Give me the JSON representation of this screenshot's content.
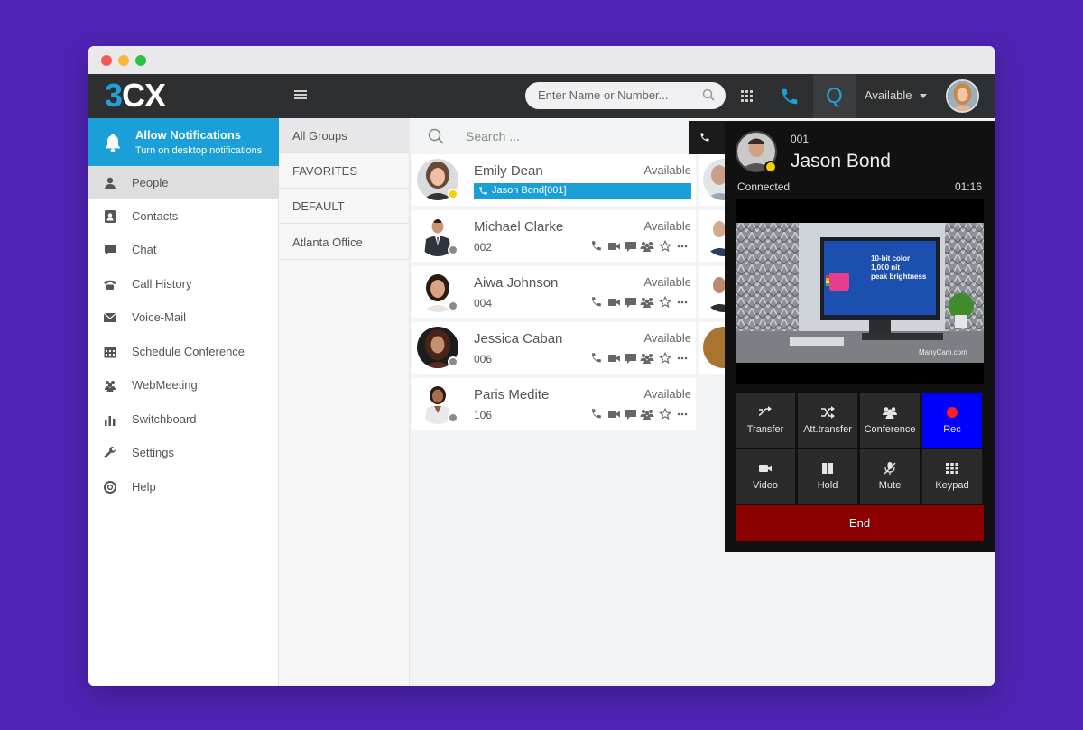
{
  "app": {
    "logo_three": "3",
    "logo_cx": "CX"
  },
  "header": {
    "search_placeholder": "Enter Name or Number...",
    "queue_label": "Q",
    "status": "Available"
  },
  "notification": {
    "title": "Allow Notifications",
    "subtitle": "Turn on desktop notifications"
  },
  "sidebar": {
    "items": [
      {
        "label": "People",
        "icon": "person-icon",
        "active": true
      },
      {
        "label": "Contacts",
        "icon": "contacts-icon"
      },
      {
        "label": "Chat",
        "icon": "chat-icon"
      },
      {
        "label": "Call History",
        "icon": "call-history-icon"
      },
      {
        "label": "Voice-Mail",
        "icon": "voicemail-icon"
      },
      {
        "label": "Schedule Conference",
        "icon": "calendar-icon"
      },
      {
        "label": "WebMeeting",
        "icon": "webmeeting-icon"
      },
      {
        "label": "Switchboard",
        "icon": "switchboard-icon"
      },
      {
        "label": "Settings",
        "icon": "wrench-icon"
      },
      {
        "label": "Help",
        "icon": "help-icon"
      }
    ]
  },
  "groups": {
    "items": [
      "All Groups",
      "FAVORITES",
      "DEFAULT",
      "Atlanta Office"
    ]
  },
  "people": {
    "search_placeholder": "Search ...",
    "contacts": [
      {
        "name": "Emily Dean",
        "status": "Available",
        "ext": "",
        "active_call": "Jason Bond[001]",
        "presence_color": "#f5d000"
      },
      {
        "name": "Michael Clarke",
        "status": "Available",
        "ext": "002",
        "presence_color": "#8a8a8a"
      },
      {
        "name": "Aiwa Johnson",
        "status": "Available",
        "ext": "004",
        "presence_color": "#8a8a8a"
      },
      {
        "name": "Jessica Caban",
        "status": "Available",
        "ext": "006",
        "presence_color": "#8a8a8a"
      },
      {
        "name": "Paris Medite",
        "status": "Available",
        "ext": "106",
        "presence_color": "#8a8a8a"
      }
    ]
  },
  "call": {
    "ext": "001",
    "name": "Jason Bond",
    "status": "Connected",
    "timer": "01:16",
    "video": {
      "monitor_line1": "10-bit color",
      "monitor_line2": "1,000 nit",
      "monitor_line3": "peak brightness",
      "watermark": "ManyCam.com"
    },
    "buttons_row1": [
      "Transfer",
      "Att.transfer",
      "Conference",
      "Rec"
    ],
    "buttons_row2": [
      "Video",
      "Hold",
      "Mute",
      "Keypad"
    ],
    "end_label": "End"
  },
  "colors": {
    "brand_blue": "#1b9fd8",
    "rec_blue": "#0000ff",
    "end_red": "#8c0000",
    "presence_yellow": "#f5d000"
  }
}
